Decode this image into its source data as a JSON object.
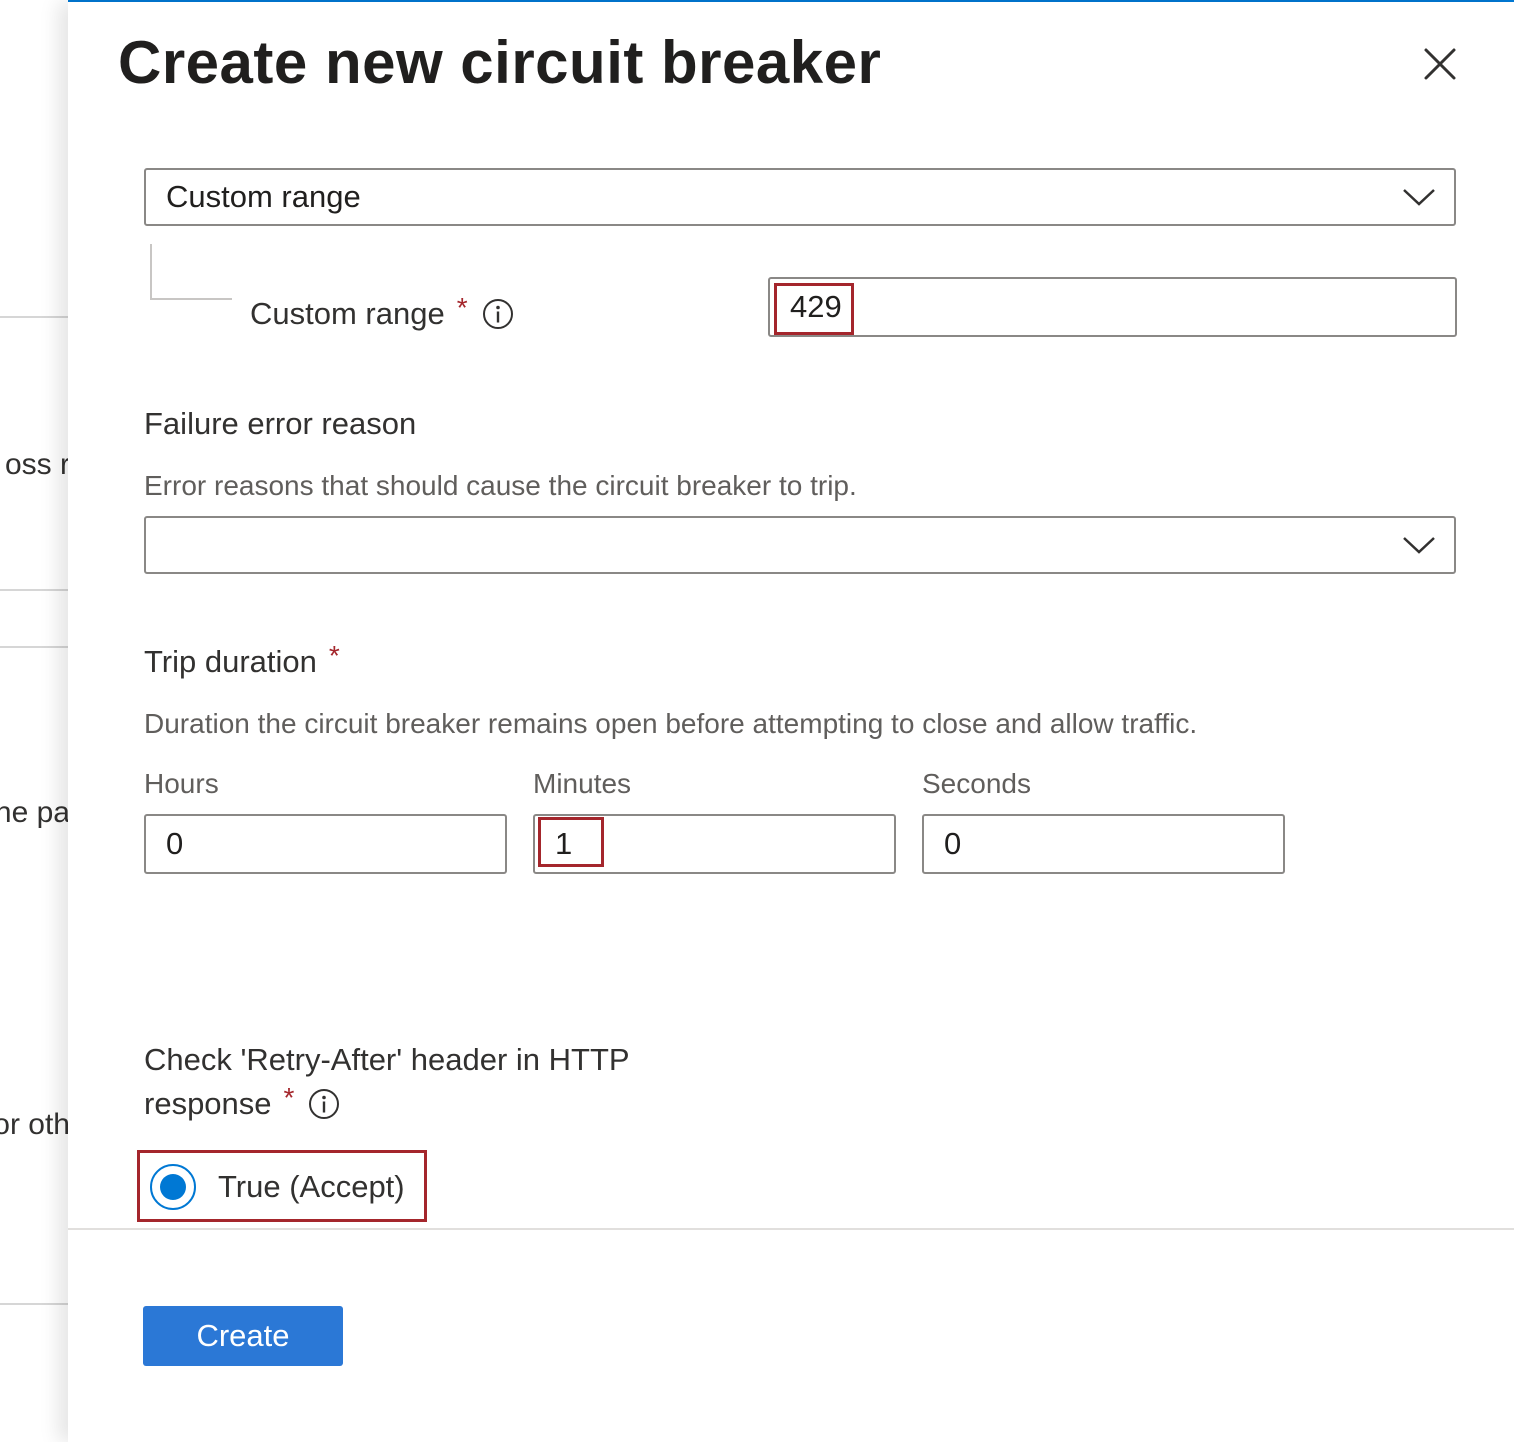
{
  "background": {
    "fragments": [
      "oss r",
      "ne pa",
      "or oth"
    ]
  },
  "panel": {
    "title": "Create new circuit breaker",
    "close_icon": "close-icon",
    "status_code_select": {
      "value": "Custom range",
      "icon": "chevron-down-icon"
    },
    "custom_range": {
      "label": "Custom range",
      "required_mark": "*",
      "icon": "info-icon",
      "value": "429"
    },
    "failure_error_reason": {
      "label": "Failure error reason",
      "description": "Error reasons that should cause the circuit breaker to trip.",
      "value": "",
      "icon": "chevron-down-icon"
    },
    "trip_duration": {
      "label": "Trip duration",
      "required_mark": "*",
      "description": "Duration the circuit breaker remains open before attempting to close and allow traffic.",
      "hours": {
        "label": "Hours",
        "value": "0"
      },
      "minutes": {
        "label": "Minutes",
        "value": "1"
      },
      "seconds": {
        "label": "Seconds",
        "value": "0"
      }
    },
    "retry_after": {
      "label_line1": "Check 'Retry-After' header in HTTP",
      "label_line2": "response",
      "required_mark": "*",
      "icon": "info-icon",
      "option_label": "True (Accept)",
      "selected": true
    },
    "create_button": "Create"
  },
  "colors": {
    "accent": "#0078d4",
    "primary_button": "#2b78d6",
    "required": "#a4262c",
    "highlight": "#a4262c"
  }
}
